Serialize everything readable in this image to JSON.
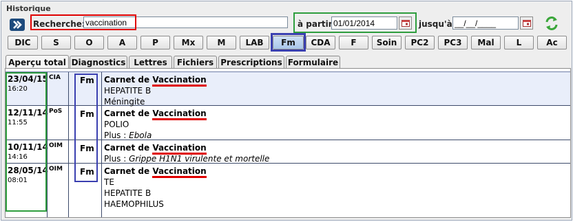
{
  "header": {
    "title": "Historique"
  },
  "search": {
    "label": "Recherche:",
    "value": "vaccination"
  },
  "from": {
    "label": "à partir:",
    "value": "01/01/2014"
  },
  "to": {
    "label": "jusqu'à:",
    "value": "__/__/____"
  },
  "filters": [
    {
      "label": "DIC"
    },
    {
      "label": "S"
    },
    {
      "label": "O"
    },
    {
      "label": "A"
    },
    {
      "label": "P"
    },
    {
      "label": "Mx"
    },
    {
      "label": "M"
    },
    {
      "label": "LAB"
    },
    {
      "label": "Fm",
      "active": true
    },
    {
      "label": "CDA"
    },
    {
      "label": "F"
    },
    {
      "label": "Soin"
    },
    {
      "label": "PC2"
    },
    {
      "label": "PC3"
    },
    {
      "label": "Mal"
    },
    {
      "label": "L"
    },
    {
      "label": "Ac"
    }
  ],
  "tabs": [
    {
      "label": "Aperçu total",
      "active": true
    },
    {
      "label": "Diagnostics"
    },
    {
      "label": "Lettres"
    },
    {
      "label": "Fichiers"
    },
    {
      "label": "Prescriptions"
    },
    {
      "label": "Formulaire"
    }
  ],
  "rows": [
    {
      "date": "23/04/15",
      "time": "16:20",
      "code": "CIA",
      "type": "Fm",
      "title_prefix": "Carnet de ",
      "title_highlight": "Vaccination",
      "lines": [
        "HEPATITE B",
        "Méningite"
      ],
      "plus": ""
    },
    {
      "date": "12/11/14",
      "time": "11:55",
      "code": "PoS",
      "type": "Fm",
      "title_prefix": "Carnet de ",
      "title_highlight": "Vaccination",
      "lines": [
        "POLIO"
      ],
      "plus": "Ebola"
    },
    {
      "date": "10/11/14",
      "time": "14:16",
      "code": "OIM",
      "type": "Fm",
      "title_prefix": "Carnet de ",
      "title_highlight": "Vaccination",
      "lines": [],
      "plus": "Grippe H1N1 virulente et mortelle"
    },
    {
      "date": "28/05/14",
      "time": "08:01",
      "code": "OIM",
      "type": "Fm",
      "title_prefix": "Carnet de ",
      "title_highlight": "Vaccination",
      "lines": [
        "TE",
        "HEPATITE B",
        "HAEMOPHILUS"
      ],
      "plus": ""
    }
  ],
  "plus_label": "Plus : ",
  "colors": {
    "highlight_red": "#e00000",
    "highlight_green": "#2e9e3e",
    "highlight_blue": "#3a3fb0"
  }
}
